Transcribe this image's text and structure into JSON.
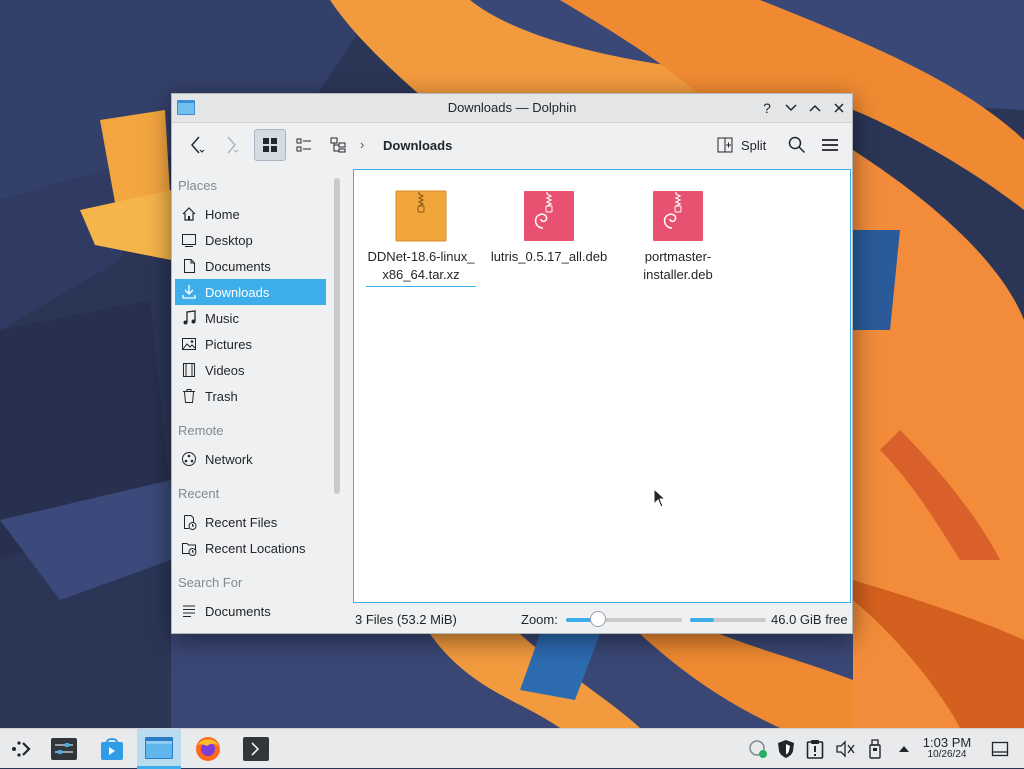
{
  "window": {
    "title": "Downloads — Dolphin",
    "controls": {
      "help": "?",
      "minimize": "⌄",
      "maximize": "⌃",
      "close": "✕"
    }
  },
  "toolbar": {
    "breadcrumb_separator": "›",
    "breadcrumb_current": "Downloads",
    "split_label": "Split"
  },
  "sidebar": {
    "places_header": "Places",
    "places": [
      {
        "label": "Home",
        "icon": "home-icon"
      },
      {
        "label": "Desktop",
        "icon": "desktop-icon"
      },
      {
        "label": "Documents",
        "icon": "documents-icon"
      },
      {
        "label": "Downloads",
        "icon": "downloads-icon",
        "selected": true
      },
      {
        "label": "Music",
        "icon": "music-icon"
      },
      {
        "label": "Pictures",
        "icon": "pictures-icon"
      },
      {
        "label": "Videos",
        "icon": "videos-icon"
      },
      {
        "label": "Trash",
        "icon": "trash-icon"
      }
    ],
    "remote_header": "Remote",
    "remote": [
      {
        "label": "Network",
        "icon": "network-icon"
      }
    ],
    "recent_header": "Recent",
    "recent": [
      {
        "label": "Recent Files",
        "icon": "recent-files-icon"
      },
      {
        "label": "Recent Locations",
        "icon": "recent-locations-icon"
      }
    ],
    "search_header": "Search For",
    "search": [
      {
        "label": "Documents",
        "icon": "search-documents-icon"
      }
    ]
  },
  "files": [
    {
      "name_line1": "DDNet-18.6-linux_",
      "name_line2": "x86_64.tar.xz",
      "icon": "archive-icon",
      "color": "#f0a63c"
    },
    {
      "name_line1": "lutris_0.5.17_all.deb",
      "name_line2": "",
      "icon": "debian-package-icon",
      "color": "#e8516f"
    },
    {
      "name_line1": "portmaster-",
      "name_line2": "installer.deb",
      "icon": "debian-package-icon",
      "color": "#e8516f"
    }
  ],
  "statusbar": {
    "file_count": "3 Files (53.2 MiB)",
    "zoom_label": "Zoom:",
    "zoom_level": 0.28,
    "space_used_fraction": 0.32,
    "free_space": "46.0 GiB free"
  },
  "taskbar": {
    "clock_time": "1:03 PM",
    "clock_date": "10/26/24"
  },
  "colors": {
    "accent": "#3daee9",
    "archive": "#f0a63c",
    "deb": "#e8516f"
  }
}
